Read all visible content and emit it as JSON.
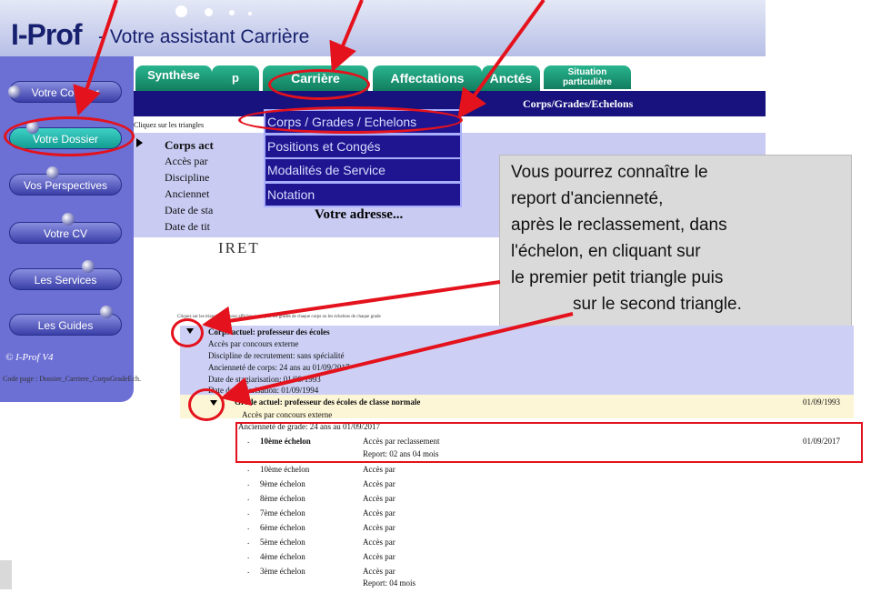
{
  "header": {
    "app_name": "I-Prof",
    "subtitle": "- Votre assistant Carrière"
  },
  "sidebar": {
    "items": [
      {
        "label": "Votre Courrier"
      },
      {
        "label": "Votre Dossier"
      },
      {
        "label": "Vos Perspectives"
      },
      {
        "label": "Votre CV"
      },
      {
        "label": "Les Services"
      },
      {
        "label": "Les Guides"
      }
    ],
    "footer": "© I-Prof  V4"
  },
  "code_page": "Code page : Dossier_Carriere_CorpsGradeEch.",
  "tabs": [
    {
      "label": "Synthèse"
    },
    {
      "label": "p"
    },
    {
      "label": "Carrière"
    },
    {
      "label": "Affectations"
    },
    {
      "label": "Anctés"
    },
    {
      "label": "Situation particulière"
    }
  ],
  "section_title": "Corps/Grades/Echelons",
  "hint_text": "Cliquez sur les triangles",
  "corps_panel": {
    "lines": [
      "Corps act",
      "Accès par",
      "Discipline",
      "Anciennet",
      "Date de sta",
      "Date de tit"
    ]
  },
  "dropdown": {
    "items": [
      {
        "label": "Corps / Grades / Echelons"
      },
      {
        "label": "Positions et Congés"
      },
      {
        "label": "Modalités de Service"
      },
      {
        "label": "Notation"
      }
    ]
  },
  "adresse_label": "Votre adresse...",
  "rbet_text": "IRET",
  "callout": {
    "lines": [
      "Vous pourrez connaître le",
      "report d'ancienneté,",
      "après le reclassement, dans",
      "l'échelon, en cliquant sur",
      "le premier petit triangle puis",
      "sur le  second triangle."
    ]
  },
  "detail": {
    "top_hint": "Cliquez sur les triangles ▸ ▾ pour afficher / masquer les grades de chaque corps ou les échelons de chaque grade",
    "corps": {
      "title": "Corps actuel: professeur des écoles",
      "lines": [
        "Accès par concours externe",
        "Discipline de recrutement: sans spécialité",
        "Ancienneté de corps: 24 ans  au 01/09/2017",
        "Date de stagiarisation: 01/09/1993",
        "Date de titularisation: 01/09/1994"
      ]
    },
    "grade": {
      "title": "Grade actuel: professeur des écoles de classe normale",
      "date": "01/09/1993",
      "acces": "Accès par concours externe",
      "anciennete": "Ancienneté de grade: 24 ans  au 01/09/2017"
    },
    "current_echelon": {
      "name": "10ème échelon",
      "acces": "Accès par reclassement",
      "report": "Report: 02 ans 04 mois",
      "date": "01/09/2017"
    },
    "echelons": [
      {
        "name": "10ème échelon",
        "acces": "Accès par"
      },
      {
        "name": "9ème échelon",
        "acces": "Accès par"
      },
      {
        "name": "8ème échelon",
        "acces": "Accès par"
      },
      {
        "name": "7ème échelon",
        "acces": "Accès par"
      },
      {
        "name": "6ème échelon",
        "acces": "Accès par"
      },
      {
        "name": "5ème échelon",
        "acces": "Accès par"
      },
      {
        "name": "4ème échelon",
        "acces": "Accès par"
      },
      {
        "name": "3ème échelon",
        "acces": "Accès par"
      }
    ],
    "last_report": "Report: 04 mois"
  },
  "colors": {
    "annotation_red": "#e4121c",
    "tab_green": "#1a9b76",
    "nav_blue": "#6c6fd4",
    "menu_navy": "#1f1590"
  }
}
